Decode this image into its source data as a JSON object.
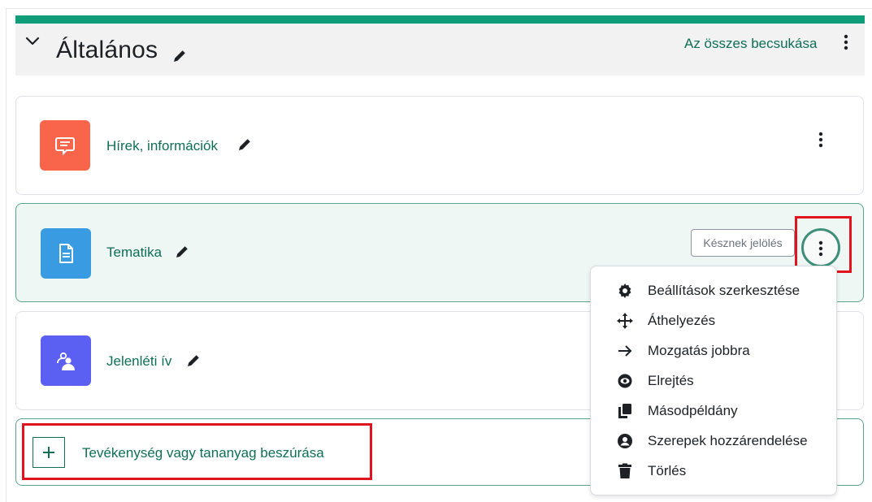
{
  "section": {
    "title": "Általános",
    "collapse_all": "Az összes becsukása"
  },
  "activities": [
    {
      "name": "Hírek, információk",
      "icon": "forum-icon",
      "color": "#f9654b"
    },
    {
      "name": "Tematika",
      "icon": "page-icon",
      "color": "#399be2"
    },
    {
      "name": "Jelenléti ív",
      "icon": "attendance-icon",
      "color": "#5b5ff2"
    }
  ],
  "mark_done_label": "Késznek jelölés",
  "add_activity_label": "Tevékenység vagy tananyag beszúrása",
  "menu": {
    "items": [
      {
        "label": "Beállítások szerkesztése",
        "icon": "gear-icon"
      },
      {
        "label": "Áthelyezés",
        "icon": "move-arrows-icon"
      },
      {
        "label": "Mozgatás jobbra",
        "icon": "arrow-right-icon"
      },
      {
        "label": "Elrejtés",
        "icon": "eye-icon"
      },
      {
        "label": "Másodpéldány",
        "icon": "copy-icon"
      },
      {
        "label": "Szerepek hozzárendelése",
        "icon": "user-circle-icon"
      },
      {
        "label": "Törlés",
        "icon": "trash-icon"
      }
    ]
  },
  "colors": {
    "accent": "#0f9d7a",
    "link": "#0f6e56",
    "highlight": "#e0141e"
  }
}
